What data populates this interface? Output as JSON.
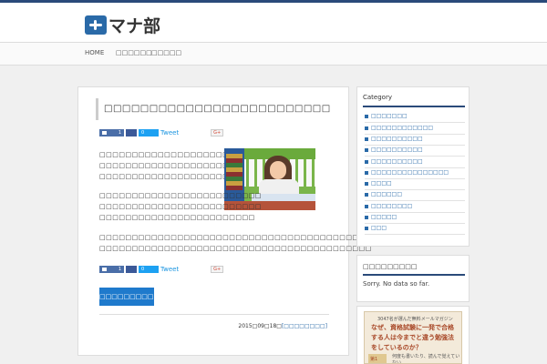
{
  "header": {
    "logo_text": "マナ部"
  },
  "nav": {
    "items": [
      "HOME",
      "□□□□□□",
      "□□□□□"
    ]
  },
  "post": {
    "title": "□□□□□□□□□□□□□□□□□□□□□□□□□",
    "share": {
      "like_count": "1",
      "share_count": "0",
      "tweet_label": "Tweet",
      "gplus_label": "G+"
    },
    "paragraphs": [
      [
        "□□□□□□□□□□□□□□□□□□□□□□□□□",
        "□□□□□□□□□□□□□□□□□□□□□□□□□",
        "□□□□□□□□□□□□□□□□□□□□□□"
      ],
      [
        "□□□□□□□□□□□□□□□□□□□□□□□□□",
        "□□□□□□□□□□□□□□□□□□□□□□□□□",
        "□□□□□□□□□□□□□□□□□□□□□□□□"
      ],
      [
        "□□□□□□□□□□□□□□□□□□□□□□□□□□□□□□□□□□□□□□□□□□",
        "□□□□□□□□□□□□□□□□□□□□□□□□□□□□□□□□□□□□□□□□□□"
      ]
    ],
    "more_label": "□□□□□□□□□□",
    "date": "2015□09□18□",
    "category_link": "[□□□□□□□□]"
  },
  "sidebar": {
    "category_title": "Category",
    "categories": [
      "□□□□□□□",
      "□□□□□□□□□□□□",
      "□□□□□□□□□□",
      "□□□□□□□□□□",
      "□□□□□□□□□□",
      "□□□□□□□□□□□□□□□",
      "□□□□",
      "□□□□□□",
      "□□□□□□□□",
      "□□□□□",
      "□□□"
    ],
    "popular_title": "□□□□□□□□□",
    "popular_empty": "Sorry. No data so far.",
    "banner": {
      "top": "3047名が選んだ無料メールマガジン",
      "main": "なぜ、資格試験に一発で合格する人は今までと違う勉強法をしているのか？",
      "step": "第1",
      "sub": "何度も書いたり、読んで覚えていない"
    }
  }
}
